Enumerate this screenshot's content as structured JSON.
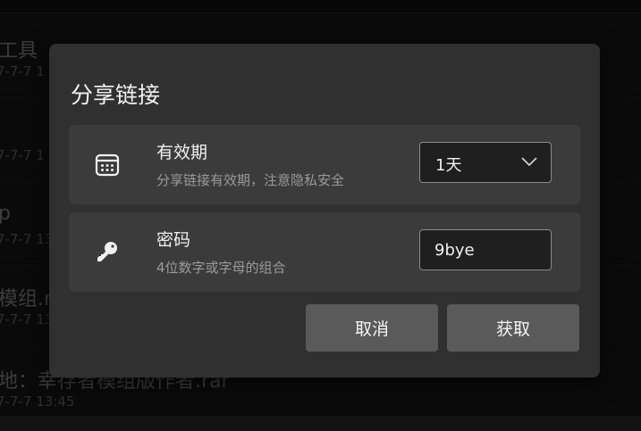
{
  "background": {
    "rows": [
      {
        "title": "工具",
        "subtitle": "7-7-7 1"
      },
      {
        "title": "",
        "subtitle": "7-7-7 1"
      },
      {
        "title": "p",
        "subtitle": "7-7-7 13"
      },
      {
        "title": "模组.ra",
        "subtitle": "7-7-7 13"
      },
      {
        "title": "地：幸存者模组版作者.rar",
        "subtitle": "7-7-7 13:45"
      }
    ]
  },
  "dialog": {
    "title": "分享链接",
    "expiry": {
      "icon": "calendar-icon",
      "title": "有效期",
      "description": "分享链接有效期，注意隐私安全",
      "selected_value": "1天"
    },
    "password": {
      "icon": "key-icon",
      "title": "密码",
      "description": "4位数字或字母的组合",
      "value": "9bye"
    },
    "buttons": {
      "cancel_label": "取消",
      "confirm_label": "获取"
    }
  }
}
